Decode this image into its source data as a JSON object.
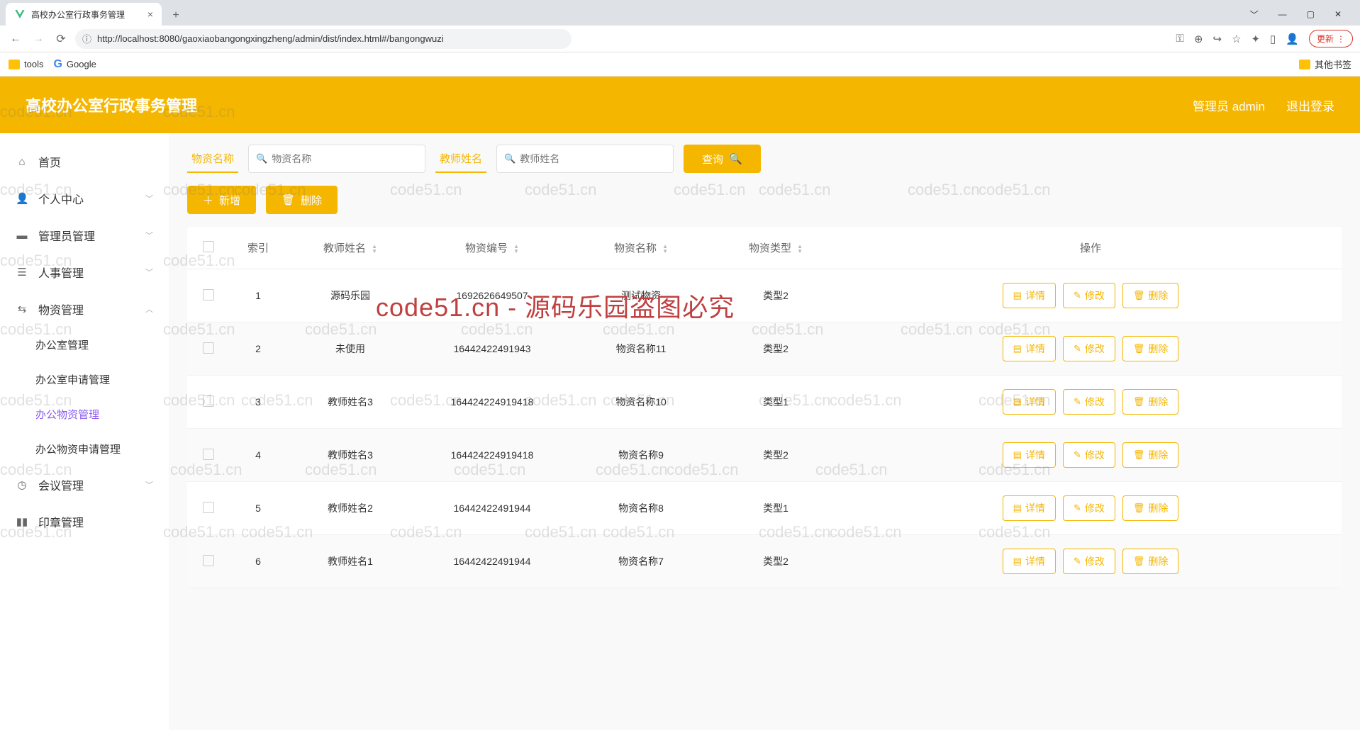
{
  "browser": {
    "tab_title": "高校办公室行政事务管理",
    "url": "http://localhost:8080/gaoxiaobangongxingzheng/admin/dist/index.html#/bangongwuzi",
    "bookmarks": {
      "tools": "tools",
      "google": "Google",
      "other": "其他书签"
    },
    "update": "更新"
  },
  "header": {
    "title": "高校办公室行政事务管理",
    "user": "管理员 admin",
    "logout": "退出登录"
  },
  "sidebar": {
    "home": "首页",
    "personal": "个人中心",
    "admin_mgmt": "管理员管理",
    "hr_mgmt": "人事管理",
    "material_mgmt": "物资管理",
    "material_children": {
      "office": "办公室管理",
      "office_apply": "办公室申请管理",
      "office_material": "办公物资管理",
      "office_material_apply": "办公物资申请管理"
    },
    "meeting_mgmt": "会议管理",
    "seal_mgmt": "印章管理"
  },
  "search": {
    "label_material": "物资名称",
    "ph_material": "物资名称",
    "label_teacher": "教师姓名",
    "ph_teacher": "教师姓名",
    "query": "查询"
  },
  "actions": {
    "add": "新增",
    "delete": "删除"
  },
  "table": {
    "headers": {
      "index": "索引",
      "teacher": "教师姓名",
      "code": "物资编号",
      "name": "物资名称",
      "type": "物资类型",
      "action": "操作"
    },
    "ops": {
      "detail": "详情",
      "edit": "修改",
      "delete": "删除"
    },
    "rows": [
      {
        "index": "1",
        "teacher": "源码乐园",
        "code": "1692626649507",
        "name": "测试物资",
        "type": "类型2"
      },
      {
        "index": "2",
        "teacher": "未使用",
        "code": "16442422491943",
        "name": "物资名称11",
        "type": "类型2"
      },
      {
        "index": "3",
        "teacher": "教师姓名3",
        "code": "164424224919418",
        "name": "物资名称10",
        "type": "类型1"
      },
      {
        "index": "4",
        "teacher": "教师姓名3",
        "code": "164424224919418",
        "name": "物资名称9",
        "type": "类型2"
      },
      {
        "index": "5",
        "teacher": "教师姓名2",
        "code": "16442422491944",
        "name": "物资名称8",
        "type": "类型1"
      },
      {
        "index": "6",
        "teacher": "教师姓名1",
        "code": "16442422491944",
        "name": "物资名称7",
        "type": "类型2"
      }
    ]
  },
  "watermark": {
    "big": "code51.cn - 源码乐园盗图必究",
    "small": "code51.cn"
  }
}
